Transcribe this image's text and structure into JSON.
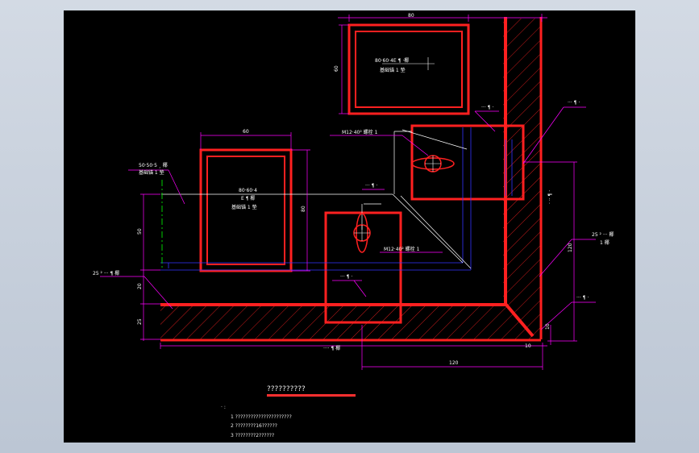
{
  "window": {
    "frame_color": "#c7d0dd",
    "canvas_color": "#000000"
  },
  "colors": {
    "profile": "#ff2020",
    "dimension": "#ff00ff",
    "leader": "#ffffff",
    "hidden": "#3333ff",
    "centerline": "#00cc00",
    "hatch": "#ff2020",
    "yellow": "#ffff00"
  },
  "drawing": {
    "dims": {
      "top_80": "80",
      "left_60": "60",
      "mid_60": "60",
      "mid_80": "80",
      "left_50": "50",
      "left_20": "20",
      "left_25": "25",
      "right_120": "120",
      "right_10": "10",
      "bottom_120": "120",
      "bottom_10": "10"
    },
    "labels": {
      "top_box_line1": "80·60·4E ¶ ·椰",
      "top_box_line2": "基础锚 1 垫",
      "mid_box_line1": "80·60·4",
      "mid_box_line2": "E ¶ 椰",
      "mid_box_line3": "基础锚 1 垫",
      "angle_line1": "50·50·5 ¸ 椰",
      "angle_line2": "基础锚 1 垫",
      "bolt_upper": "M12·40² 螺栓 1",
      "bolt_lower": "M12·40² 螺栓 1",
      "right_top": "··· ¶ ·",
      "right_mid": "· ·· ¶ ·",
      "right_25": "25 ² ··· 椰",
      "right_25b": "1 椰",
      "right_low": "··· ¶ ·",
      "left_25": "25 ² ··· ¶ 椰",
      "plate_upper": "··· ¶ ·",
      "plate_lower": "··· ¶ ·",
      "lower_box": "··· ¶ ·",
      "wall_bottom": "···· ¶ 椰"
    },
    "title": "??????????",
    "notes_heading": "· :",
    "notes": [
      "1  ??????????????????????",
      "2  ????????16??????",
      "3  ????????2??????"
    ]
  }
}
